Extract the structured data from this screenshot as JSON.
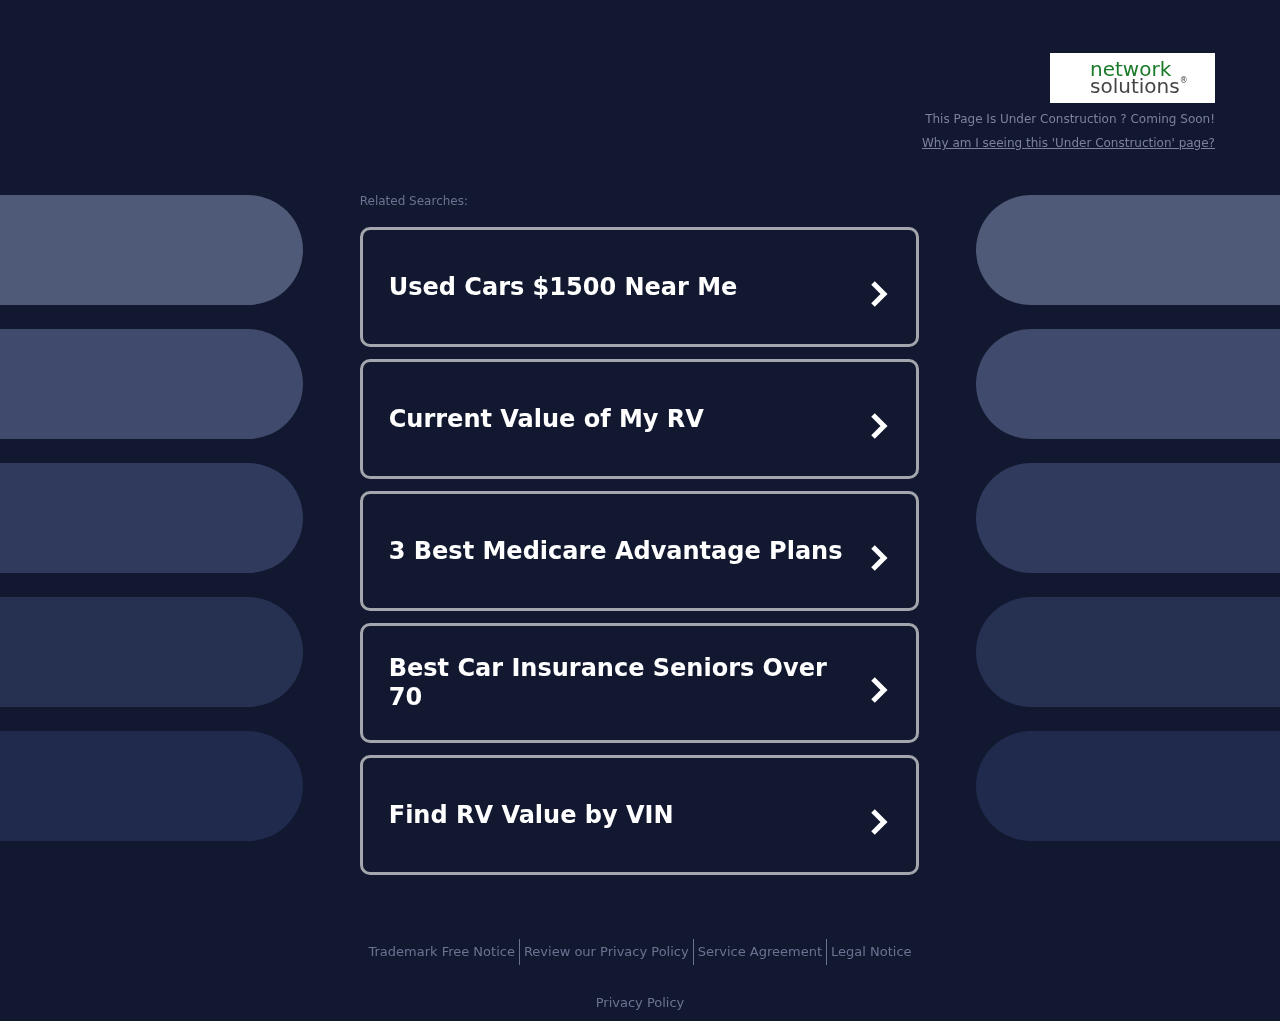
{
  "logo": {
    "line_1": "network",
    "line_2": "solutions",
    "mark": "®"
  },
  "notice": "This Page Is Under Construction ? Coming Soon!",
  "notice_link": "Why am I seeing this 'Under Construction' page?",
  "related_label": "Related Searches:",
  "searches": [
    {
      "label": "Used Cars $1500 Near Me"
    },
    {
      "label": "Current Value of My RV"
    },
    {
      "label": "3 Best Medicare Advantage Plans"
    },
    {
      "label": "Best Car Insurance Seniors Over 70"
    },
    {
      "label": "Find RV Value by VIN"
    }
  ],
  "footer_links": [
    "Trademark Free Notice",
    "Review our Privacy Policy",
    "Service Agreement",
    "Legal Notice"
  ],
  "privacy_link": "Privacy Policy"
}
